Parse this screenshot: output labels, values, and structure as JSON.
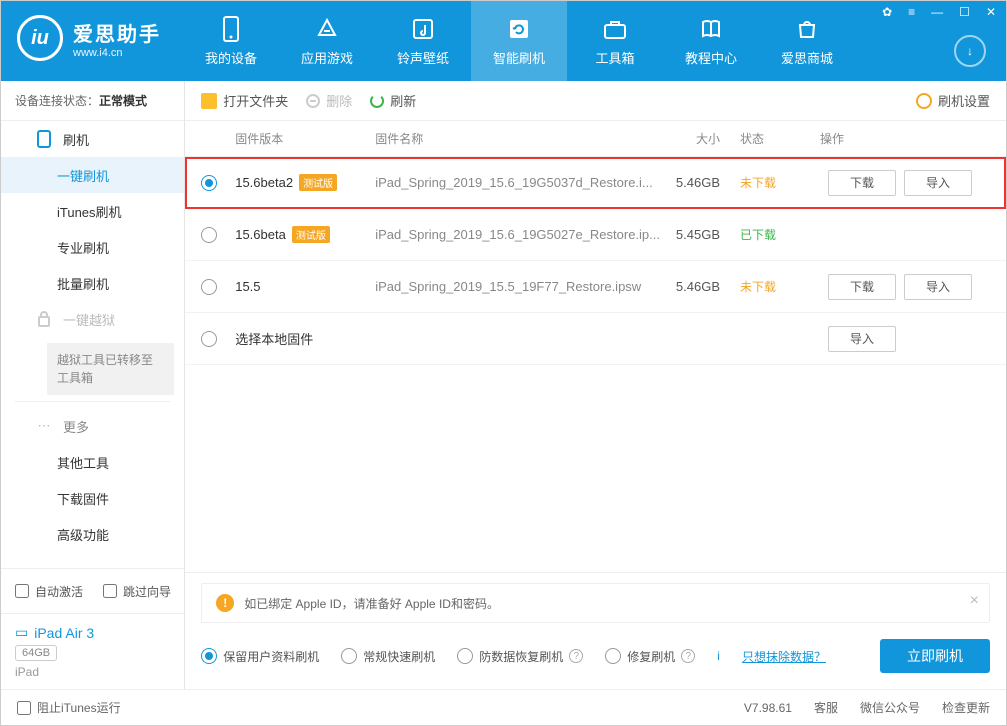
{
  "brand": {
    "name": "爱思助手",
    "url": "www.i4.cn"
  },
  "tabs": [
    {
      "label": "我的设备"
    },
    {
      "label": "应用游戏"
    },
    {
      "label": "铃声壁纸"
    },
    {
      "label": "智能刷机",
      "active": true
    },
    {
      "label": "工具箱"
    },
    {
      "label": "教程中心"
    },
    {
      "label": "爱思商城"
    }
  ],
  "conn_status": {
    "label": "设备连接状态：",
    "value": "正常模式"
  },
  "sidebar": {
    "flash_group": "刷机",
    "items": [
      "一键刷机",
      "iTunes刷机",
      "专业刷机",
      "批量刷机"
    ],
    "jailbreak": "一键越狱",
    "jailbreak_note": "越狱工具已转移至工具箱",
    "more": "更多",
    "more_items": [
      "其他工具",
      "下载固件",
      "高级功能"
    ]
  },
  "side_bottom": {
    "auto_activate": "自动激活",
    "skip_guide": "跳过向导"
  },
  "device": {
    "name": "iPad Air 3",
    "storage": "64GB",
    "type": "iPad"
  },
  "toolbar": {
    "open_folder": "打开文件夹",
    "delete": "删除",
    "refresh": "刷新",
    "settings": "刷机设置"
  },
  "thead": {
    "ver": "固件版本",
    "name": "固件名称",
    "size": "大小",
    "status": "状态",
    "ops": "操作"
  },
  "rows": [
    {
      "selected": true,
      "highlight": true,
      "ver": "15.6beta2",
      "tag": "测试版",
      "name": "iPad_Spring_2019_15.6_19G5037d_Restore.i...",
      "size": "5.46GB",
      "status": "未下载",
      "status_cls": "status-nd",
      "download": "下载",
      "import": "导入"
    },
    {
      "selected": false,
      "ver": "15.6beta",
      "tag": "测试版",
      "name": "iPad_Spring_2019_15.6_19G5027e_Restore.ip...",
      "size": "5.45GB",
      "status": "已下载",
      "status_cls": "status-d"
    },
    {
      "selected": false,
      "ver": "15.5",
      "name": "iPad_Spring_2019_15.5_19F77_Restore.ipsw",
      "size": "5.46GB",
      "status": "未下载",
      "status_cls": "status-nd",
      "download": "下载",
      "import": "导入"
    },
    {
      "selected": false,
      "ver": "选择本地固件",
      "local": true,
      "import": "导入"
    }
  ],
  "notice": "如已绑定 Apple ID，请准备好 Apple ID和密码。",
  "flash_options": [
    {
      "label": "保留用户资料刷机",
      "selected": true
    },
    {
      "label": "常规快速刷机"
    },
    {
      "label": "防数据恢复刷机",
      "help": true
    },
    {
      "label": "修复刷机",
      "help": true
    }
  ],
  "erase_link": "只想抹除数据？",
  "flash_now": "立即刷机",
  "statusbar": {
    "block_itunes": "阻止iTunes运行",
    "version": "V7.98.61",
    "support": "客服",
    "wechat": "微信公众号",
    "update": "检查更新"
  }
}
